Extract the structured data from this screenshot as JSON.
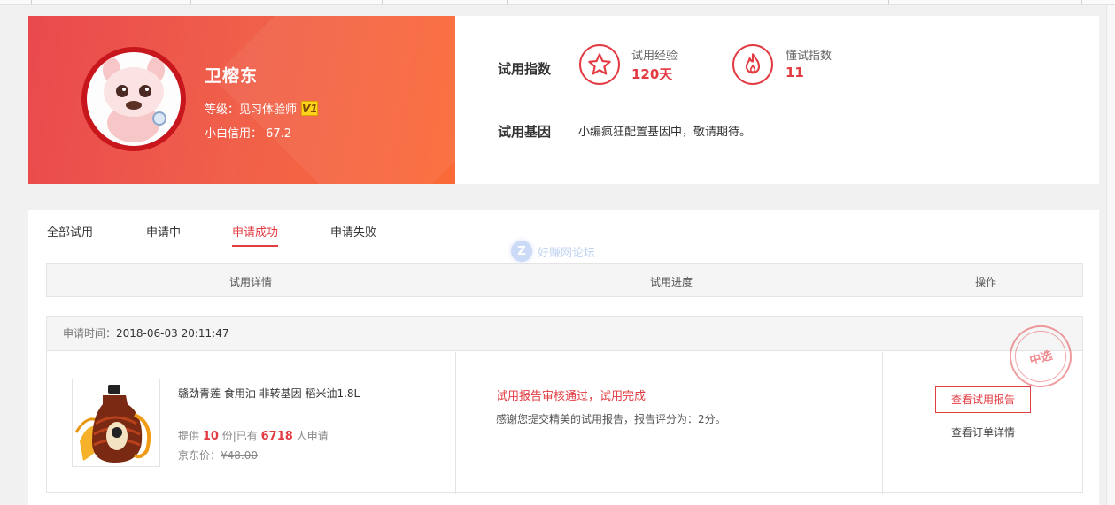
{
  "profile": {
    "name": "卫榕东",
    "level_text": "等级：见习体验师",
    "level_badge": "V1",
    "credit_text": "小白信用： 67.2"
  },
  "stats": {
    "index_title": "试用指数",
    "experience": {
      "label": "试用经验",
      "value": "120天",
      "icon": "star-icon"
    },
    "dongshi": {
      "label": "懂试指数",
      "value": "11",
      "icon": "flame-icon"
    },
    "gene_title": "试用基因",
    "gene_text": "小编疯狂配置基因中，敬请期待。"
  },
  "tabs": [
    {
      "label": "全部试用",
      "active": false
    },
    {
      "label": "申请中",
      "active": false
    },
    {
      "label": "申请成功",
      "active": true
    },
    {
      "label": "申请失败",
      "active": false
    }
  ],
  "watermark": {
    "logo": "Z",
    "text": "好赚网论坛"
  },
  "table": {
    "headers": [
      "试用详情",
      "试用进度",
      "操作"
    ]
  },
  "order": {
    "apply_time_label": "申请时间：",
    "apply_time": "2018-06-03 20:11:47",
    "product": {
      "name": "赣劲青莲 食用油 非转基因 稻米油1.8L",
      "supply_prefix": "提供",
      "supply_count": "10",
      "supply_mid": "份|已有",
      "applicants": "6718",
      "supply_suffix": "人申请",
      "price_label": "京东价：",
      "price": "¥48.00"
    },
    "progress": {
      "status": "试用报告审核通过，试用完成",
      "description": "感谢您提交精美的试用报告，报告评分为：2分。"
    },
    "actions": {
      "report_button": "查看试用报告",
      "order_link": "查看订单详情"
    },
    "stamp": "中选"
  },
  "colors": {
    "accent": "#e23b41",
    "banner_start": "#e9494d",
    "banner_end": "#fb6a37"
  }
}
